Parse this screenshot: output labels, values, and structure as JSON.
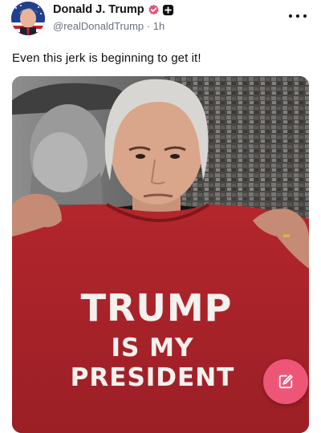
{
  "post": {
    "author_name": "Donald J. Trump",
    "handle": "@realDonaldTrump",
    "separator": " · ",
    "time": "1h",
    "text": "Even this jerk is beginning to get it!",
    "verified_badge_icon": "verified-badge-icon",
    "more_icon": "more-options-icon"
  },
  "media": {
    "shirt_line_1": "TRUMP",
    "shirt_line_2": "IS MY",
    "shirt_line_3": "PRESIDENT"
  },
  "fab": {
    "icon": "compose-icon"
  },
  "colors": {
    "fab": "#ee5678",
    "verified": "#e2557a",
    "shirt": "#a9252b",
    "handle_text": "#6b7280"
  }
}
